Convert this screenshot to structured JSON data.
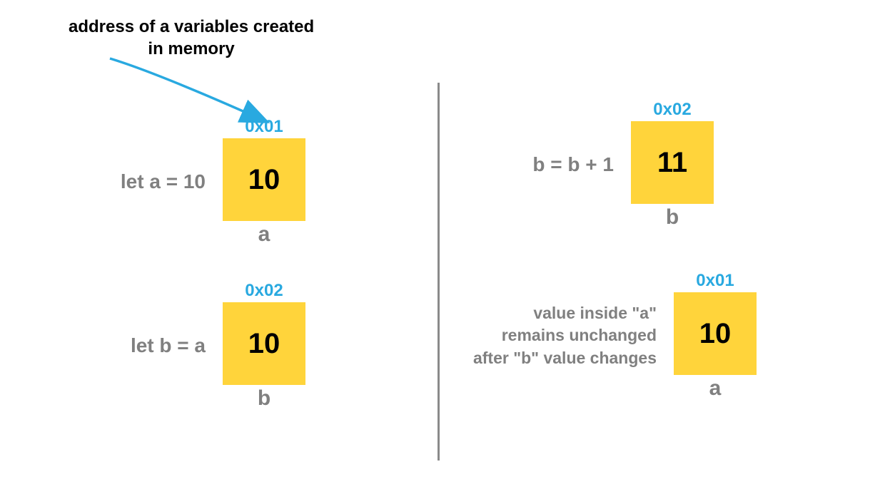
{
  "annotation": {
    "line1": "address of a variables created",
    "line2": "in memory"
  },
  "colors": {
    "arrow": "#29a9e0",
    "box_bg": "#ffd43b",
    "label_text": "#808080",
    "address_text": "#29a9e0"
  },
  "cells": {
    "a1": {
      "label": "let a = 10",
      "address": "0x01",
      "value": "10",
      "var": "a"
    },
    "b1": {
      "label": "let b = a",
      "address": "0x02",
      "value": "10",
      "var": "b"
    },
    "b2": {
      "label": "b = b + 1",
      "address": "0x02",
      "value": "11",
      "var": "b"
    },
    "a2": {
      "label_line1": "value inside \"a\"",
      "label_line2": "remains unchanged",
      "label_line3": "after \"b\" value changes",
      "address": "0x01",
      "value": "10",
      "var": "a"
    }
  }
}
